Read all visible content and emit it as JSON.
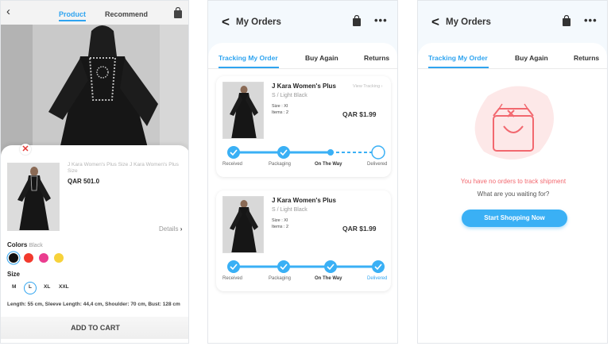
{
  "product_screen": {
    "tabs": [
      "Product",
      "Recommend"
    ],
    "back_icon": "chevron-left-icon",
    "bag_icon": "shopping-bag-icon",
    "close_icon": "close-icon",
    "product_name": "J Kara Women's Plus Size J Kara Women's Plus Size",
    "price": "QAR  501.0",
    "details_link": "Details",
    "colors_label": "Colors",
    "selected_color": "Black",
    "colors": [
      "#111111",
      "#f23a2e",
      "#ea3d8f",
      "#f7d23a"
    ],
    "size_label": "Size",
    "sizes": [
      "M",
      "L",
      "XL",
      "XXL"
    ],
    "selected_size": "L",
    "measurements": "Length: 55 cm, Sleeve Length: 44,4 cm, Shoulder: 70 cm, Bust: 128 cm",
    "add_to_cart": "ADD TO CART"
  },
  "orders_screen": {
    "title": "My Orders",
    "tabs": [
      "Tracking My Order",
      "Buy Again",
      "Returns"
    ],
    "orders": [
      {
        "name": "J Kara Women's Plus",
        "variant": "S / Light Black",
        "size": "Size : Xl",
        "items": "Items : 2",
        "price": "QAR $1.99",
        "view_tracking": "View Tracking",
        "steps": [
          "Received",
          "Packaging",
          "On The Way",
          "Delivered"
        ]
      },
      {
        "name": "J Kara Women's Plus",
        "variant": "S / Light Black",
        "size": "Size : Xl",
        "items": "Items : 2",
        "price": "QAR $1.99",
        "steps": [
          "Received",
          "Packaging",
          "On The Way",
          "Delivered"
        ]
      }
    ]
  },
  "empty_screen": {
    "title": "My Orders",
    "tabs": [
      "Tracking My Order",
      "Buy Again",
      "Returns"
    ],
    "empty_icon": "empty-bag-icon",
    "message": "You have no orders to track shipment",
    "submessage": "What are you waiting for?",
    "cta": "Start Shopping Now"
  },
  "colors": {
    "accent": "#2fa4f0",
    "error": "#f2686f",
    "cta": "#3ab0f5"
  }
}
